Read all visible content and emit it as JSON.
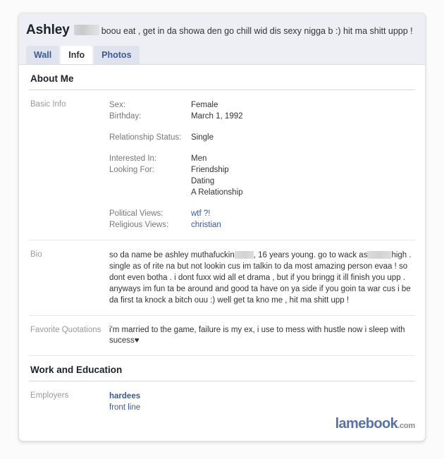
{
  "profile": {
    "name": "Ashley",
    "name_redacted": true,
    "status": "boou eat , get in da showa den go chill wid dis sexy nigga b :) hit ma shitt uppp !"
  },
  "tabs": [
    {
      "label": "Wall",
      "active": false
    },
    {
      "label": "Info",
      "active": true
    },
    {
      "label": "Photos",
      "active": false
    }
  ],
  "sections": {
    "about_me": {
      "title": "About Me",
      "basic_info": {
        "label": "Basic Info",
        "groups": [
          {
            "pairs": [
              {
                "key": "Sex:",
                "value": "Female"
              },
              {
                "key": "Birthday:",
                "value": "March 1, 1992"
              }
            ]
          },
          {
            "pairs": [
              {
                "key": "Relationship Status:",
                "value": "Single"
              }
            ]
          },
          {
            "pairs": [
              {
                "key": "Interested In:",
                "value": "Men"
              },
              {
                "key": "Looking For:",
                "value": "Friendship"
              }
            ],
            "extra_values": [
              "Dating",
              "A Relationship"
            ]
          },
          {
            "pairs": [
              {
                "key": "Political Views:",
                "value": "wtf ?!",
                "link": true
              },
              {
                "key": "Religious Views:",
                "value": "christian",
                "link": true
              }
            ]
          }
        ]
      },
      "bio": {
        "label": "Bio",
        "text_part_1": "so da name be ashley muthafuckin",
        "text_part_2": ", 16 years young. go to wack as",
        "text_part_3": "high . single as of rite na but not lookin cus im talkin to da most amazing person evaa ! so dont even botha . i dont fuxx wid all et drama , but if you bringg it ill finish you upp . anyways im fun ta be around and good ta have on ya side if you goin ta war cus i be da first ta knock a bitch ouu :) well get ta kno me , hit ma shitt upp !"
      },
      "favorite_quotations": {
        "label": "Favorite Quotations",
        "text": "i'm married to the game, failure is my ex, i use to mess with hustle now i sleep with sucess♥"
      }
    },
    "work_and_education": {
      "title": "Work and Education",
      "employers": {
        "label": "Employers",
        "primary": "hardees",
        "secondary": "front line"
      }
    }
  },
  "watermark": {
    "name": "lamebook",
    "tld": ".com"
  },
  "colors": {
    "facebook_blue": "#3b5998",
    "header_band": "#edeff4",
    "tab_inactive": "#dfe3ee",
    "label_gray": "#999999",
    "text": "#333333"
  }
}
